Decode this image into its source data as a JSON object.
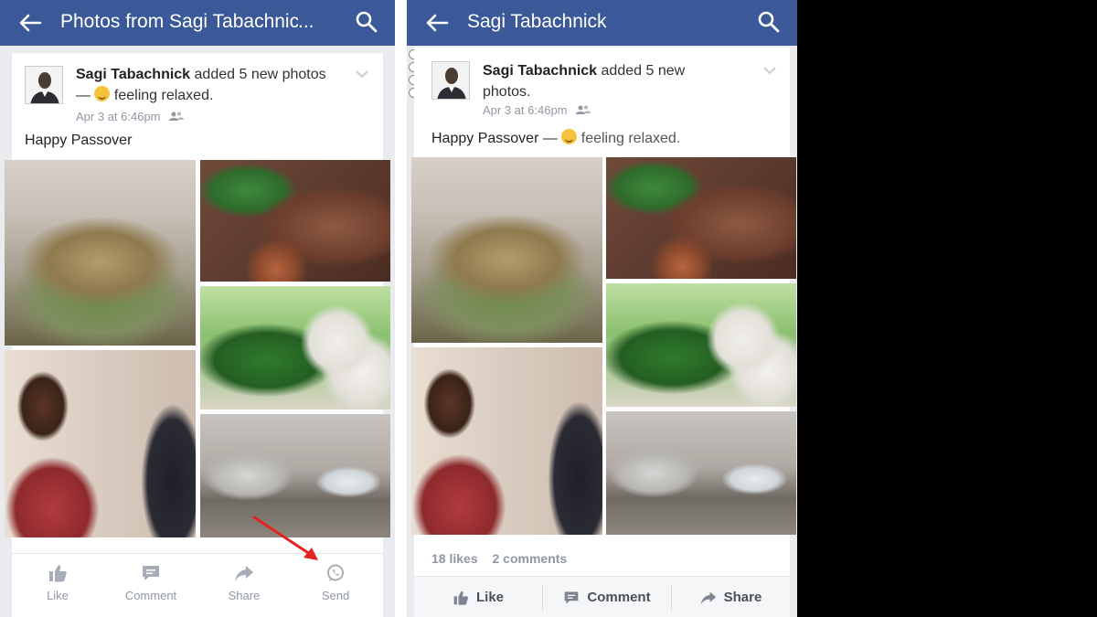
{
  "left": {
    "header": {
      "title": "Photos from Sagi Tabachnick",
      "back_icon": "back-arrow-icon",
      "search_icon": "search-icon"
    },
    "post": {
      "author": "Sagi Tabachnick",
      "action": "added 5 new photos —",
      "feeling": "feeling relaxed.",
      "timestamp": "Apr 3 at 6:46pm",
      "caption": "Happy Passover"
    },
    "actions": [
      {
        "label": "Like",
        "icon": "thumbs-up-icon"
      },
      {
        "label": "Comment",
        "icon": "comment-icon"
      },
      {
        "label": "Share",
        "icon": "share-icon"
      },
      {
        "label": "Send",
        "icon": "whatsapp-icon"
      }
    ]
  },
  "right": {
    "header": {
      "title": "Sagi Tabachnick",
      "back_icon": "back-arrow-icon",
      "search_icon": "search-icon"
    },
    "post": {
      "author": "Sagi Tabachnick",
      "action": "added 5 new photos.",
      "timestamp": "Apr 3 at 6:46pm",
      "caption": "Happy Passover —",
      "feeling": "feeling relaxed."
    },
    "stats": {
      "likes": "18 likes",
      "comments": "2 comments"
    },
    "actions": [
      {
        "label": "Like",
        "icon": "thumbs-up-icon"
      },
      {
        "label": "Comment",
        "icon": "comment-icon"
      },
      {
        "label": "Share",
        "icon": "share-icon"
      }
    ]
  },
  "colors": {
    "header": "#3b5998",
    "annotation_arrow": "#e3231f"
  }
}
